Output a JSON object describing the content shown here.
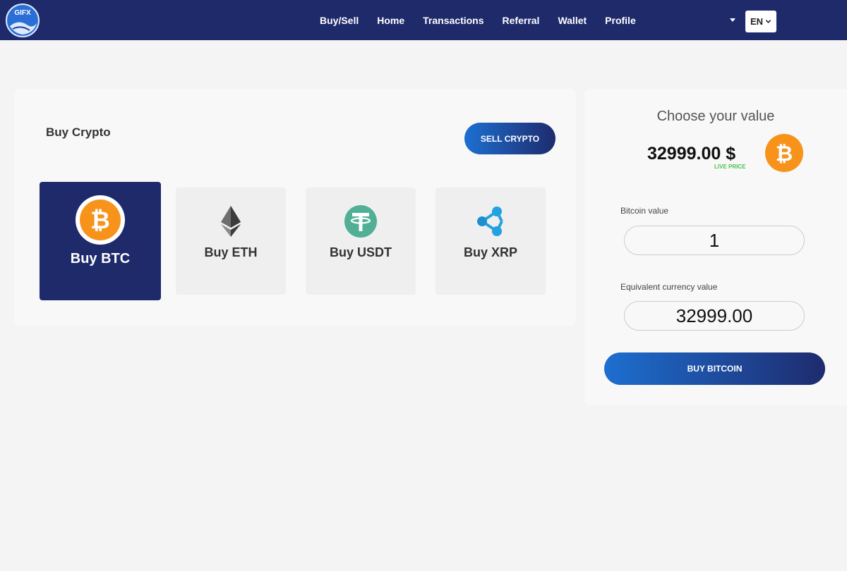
{
  "nav": {
    "logo_text": "GIFX",
    "links": [
      "Buy/Sell",
      "Home",
      "Transactions",
      "Referral",
      "Wallet",
      "Profile"
    ],
    "language": "EN"
  },
  "buy_panel": {
    "title": "Buy Crypto",
    "sell_button": "SELL CRYPTO",
    "coins": [
      {
        "label": "Buy BTC",
        "icon": "bitcoin-icon",
        "active": true
      },
      {
        "label": "Buy ETH",
        "icon": "ethereum-icon",
        "active": false
      },
      {
        "label": "Buy USDT",
        "icon": "tether-icon",
        "active": false
      },
      {
        "label": "Buy XRP",
        "icon": "ripple-icon",
        "active": false
      }
    ]
  },
  "value_panel": {
    "title": "Choose your value",
    "price": "32999.00 $",
    "live_label": "LIVE PRICE",
    "bitcoin_label": "Bitcoin value",
    "bitcoin_value": "1",
    "currency_label": "Equivalent currency value",
    "currency_value": "32999.00",
    "buy_button": "BUY BITCOIN"
  },
  "colors": {
    "navbar": "#1f2a6b",
    "accent_start": "#1d6fd0",
    "accent_end": "#1e2b6e",
    "bitcoin": "#f7931a",
    "tether": "#50af95",
    "ripple": "#23a1e0",
    "live": "#4cc24c"
  }
}
